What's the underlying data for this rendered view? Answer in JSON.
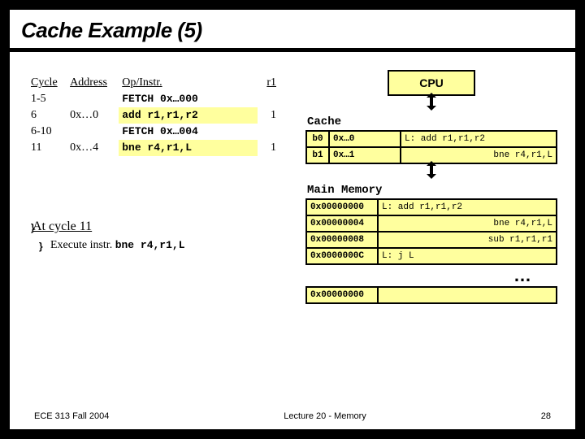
{
  "title": "Cache Example (5)",
  "trace": {
    "headers": {
      "cycle": "Cycle",
      "address": "Address",
      "op": "Op/Instr.",
      "r1": "r1"
    },
    "rows": [
      {
        "cycle": "1-5",
        "address": "",
        "op": "FETCH 0x…000",
        "r1": "",
        "mono_op": true
      },
      {
        "cycle": "6",
        "address": "0x…0",
        "op": "add r1,r1,r2",
        "r1": "1",
        "hl": true
      },
      {
        "cycle": "6-10",
        "address": "",
        "op": "FETCH 0x…004",
        "r1": "",
        "mono_op": true
      },
      {
        "cycle": "11",
        "address": "0x…4",
        "op": "bne r4,r1,L",
        "r1": "1",
        "hl": true
      }
    ]
  },
  "cpu_label": "CPU",
  "cache": {
    "label": "Cache",
    "rows": [
      {
        "idx": "b0",
        "addr": "0x…0",
        "instr": "L: add r1,r1,r2"
      },
      {
        "idx": "b1",
        "addr": "0x…1",
        "instr": "bne r4,r1,L"
      }
    ]
  },
  "memory": {
    "label": "Main Memory",
    "rows": [
      {
        "addr": "0x00000000",
        "instr": "L: add r1,r1,r2"
      },
      {
        "addr": "0x00000004",
        "instr": "bne r4,r1,L"
      },
      {
        "addr": "0x00000008",
        "instr": "sub r1,r1,r1"
      },
      {
        "addr": "0x0000000C",
        "instr": "L: j L"
      }
    ],
    "ellipsis": "…",
    "tail_addr": "0x00000000"
  },
  "bullets": {
    "b1_prefix": "At ",
    "b1_text": "cycle 11",
    "b2_text": "Execute instr. ",
    "b2_mono": "bne r4,r1,L",
    "icon": "}"
  },
  "footer": {
    "left": "ECE 313 Fall 2004",
    "center": "Lecture 20 - Memory",
    "right": "28"
  }
}
